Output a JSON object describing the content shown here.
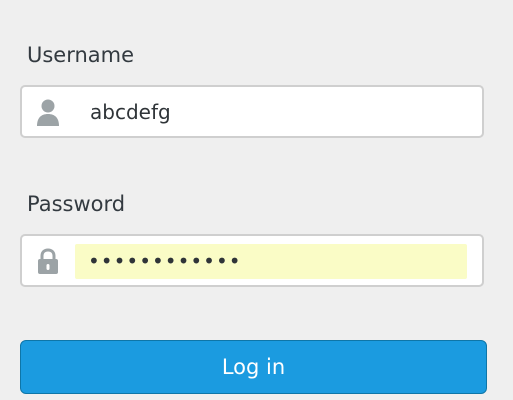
{
  "login_form": {
    "username": {
      "label": "Username",
      "value": "abcdefg",
      "icon": "user-icon"
    },
    "password": {
      "label": "Password",
      "masked_value": "••••••••••••",
      "icon": "lock-icon",
      "autofill_color": "#fafcc6"
    },
    "submit": {
      "label": "Log in",
      "color": "#1b9be0"
    }
  }
}
